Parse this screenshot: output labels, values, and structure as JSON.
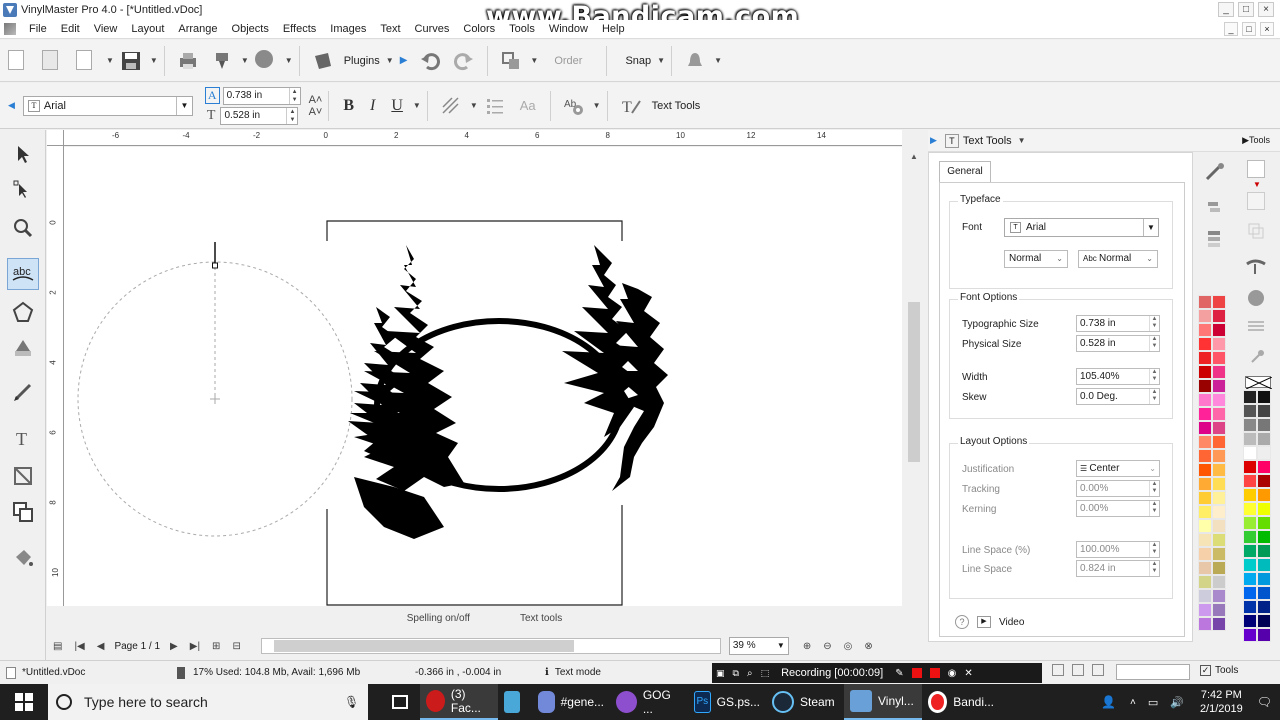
{
  "window": {
    "title": "VinylMaster Pro 4.0 - [*Untitled.vDoc]",
    "watermark": "www.Bandicam.com",
    "controls": [
      "_",
      "□",
      "×"
    ]
  },
  "menu": [
    "File",
    "Edit",
    "View",
    "Layout",
    "Arrange",
    "Objects",
    "Effects",
    "Images",
    "Text",
    "Curves",
    "Colors",
    "Tools",
    "Window",
    "Help"
  ],
  "toolbar1": {
    "plugins_label": "Plugins",
    "order_label": "Order",
    "snap_label": "Snap"
  },
  "toolbar2": {
    "font_name": "Arial",
    "typographic_size": "0.738 in",
    "physical_size": "0.528 in",
    "bold": "B",
    "italic": "I",
    "underline": "U",
    "text_tools_label": "Text Tools"
  },
  "ruler_h": [
    "-6",
    "-4",
    "-2",
    "0",
    "2",
    "4",
    "6",
    "8",
    "10",
    "12",
    "14"
  ],
  "ruler_v": [
    "0",
    "2",
    "4",
    "6",
    "8",
    "10"
  ],
  "canvas_bottom": {
    "spelling": "Spelling on/off",
    "text_tools": "Text tools"
  },
  "navbar": {
    "page": "Page 1 / 1",
    "zoom": "39 %"
  },
  "panel": {
    "header": "Text Tools",
    "tools_link": "Tools",
    "tab_general": "General",
    "typeface": {
      "title": "Typeface",
      "font_label": "Font",
      "font_value": "Arial",
      "style_value": "Normal",
      "variant_value": "Normal"
    },
    "font_options": {
      "title": "Font Options",
      "typo_label": "Typographic Size",
      "typo_value": "0.738 in",
      "phys_label": "Physical Size",
      "phys_value": "0.528 in",
      "width_label": "Width",
      "width_value": "105.40%",
      "skew_label": "Skew",
      "skew_value": "0.0 Deg."
    },
    "layout_options": {
      "title": "Layout Options",
      "justification_label": "Justification",
      "justification_value": "Center",
      "tracking_label": "Tracking",
      "tracking_value": "0.00%",
      "kerning_label": "Kerning",
      "kerning_value": "0.00%",
      "linespace_pct_label": "Line Space (%)",
      "linespace_pct_value": "100.00%",
      "linespace_label": "Line Space",
      "linespace_value": "0.824 in"
    },
    "video_label": "Video"
  },
  "statusbar": {
    "file": "*Untitled.vDoc",
    "memory": "17%   Used: 104.8 Mb, Avail: 1,696 Mb",
    "coords": "-0.366 in , -0.004 in",
    "mode": "Text mode",
    "tools": "Tools"
  },
  "recording": "Recording [00:00:09]",
  "taskbar": {
    "search_placeholder": "Type here to search",
    "tasks": [
      "(3) Fac...",
      "",
      "#gene...",
      "GOG ...",
      "GS.ps...",
      "Steam",
      "Vinyl...",
      "Bandi..."
    ],
    "time": "7:42 PM",
    "date": "2/1/2019"
  },
  "colors": {
    "accent": "#cfe3f7",
    "taskbar": "#1f1f1f",
    "palette_col1": [
      "#e06666",
      "#f4a0a0",
      "#ff7777",
      "#ff3333",
      "#ee2222",
      "#cc0000",
      "#990000",
      "#ff77cc",
      "#ff2299",
      "#dd0088",
      "#ff8866",
      "#ff6633",
      "#ff5500",
      "#ffaa33",
      "#ffcc33",
      "#ffee66",
      "#ffffaa",
      "#f7e4b6",
      "#f5d0a8",
      "#e8c6a8",
      "#d4d488",
      "#ccccdd",
      "#cc99ee",
      "#bb77dd",
      "#9966cc",
      "#8844bb",
      "#7733aa",
      "#6622aa",
      "#9999ff",
      "#7777ee",
      "#5555dd",
      "#4444cc",
      "#cc88ff",
      "#8855cc",
      "#7766aa",
      "#aaaacc"
    ],
    "palette_col2": [
      "#ee4444",
      "#dd2244",
      "#cc0033",
      "#ff99aa",
      "#ff5566",
      "#ee3388",
      "#cc2299",
      "#ff88dd",
      "#ff66aa",
      "#dd4488",
      "#ff6633",
      "#ff9955",
      "#ffbb44",
      "#ffdd55",
      "#fff199",
      "#ffeecc",
      "#f3e0c0",
      "#dddd77",
      "#ccbb66",
      "#bbaa55",
      "#cccccc",
      "#aa88cc",
      "#9977bb",
      "#7744aa",
      "#663399",
      "#552288",
      "#8888ee",
      "#6666dd",
      "#4444bb",
      "#333399",
      "#aa77ee",
      "#8866cc",
      "#7766aa",
      "#555599",
      "#333377",
      "#222255"
    ],
    "palette2_col1": [
      "#222222",
      "#555555",
      "#888888",
      "#bbbbbb",
      "#ffffff",
      "#dd0000",
      "#ff4444",
      "#ffcc00",
      "#ffff33",
      "#99ee33",
      "#33cc33",
      "#00aa66",
      "#00cccc",
      "#00aaee",
      "#0066ee",
      "#0033aa",
      "#000077",
      "#6600cc",
      "#9900cc",
      "#cc00cc",
      "#ff00aa",
      "#222222"
    ],
    "palette2_col2": [
      "#111111",
      "#444444",
      "#777777",
      "#aaaaaa",
      "#eeeeee",
      "#ff0066",
      "#aa0000",
      "#ff9900",
      "#eeff00",
      "#66dd00",
      "#00bb00",
      "#009955",
      "#00bbbb",
      "#0099dd",
      "#0055cc",
      "#002288",
      "#000055",
      "#5500aa",
      "#7700aa",
      "#aa00aa",
      "#dd0088",
      "#000000"
    ]
  }
}
